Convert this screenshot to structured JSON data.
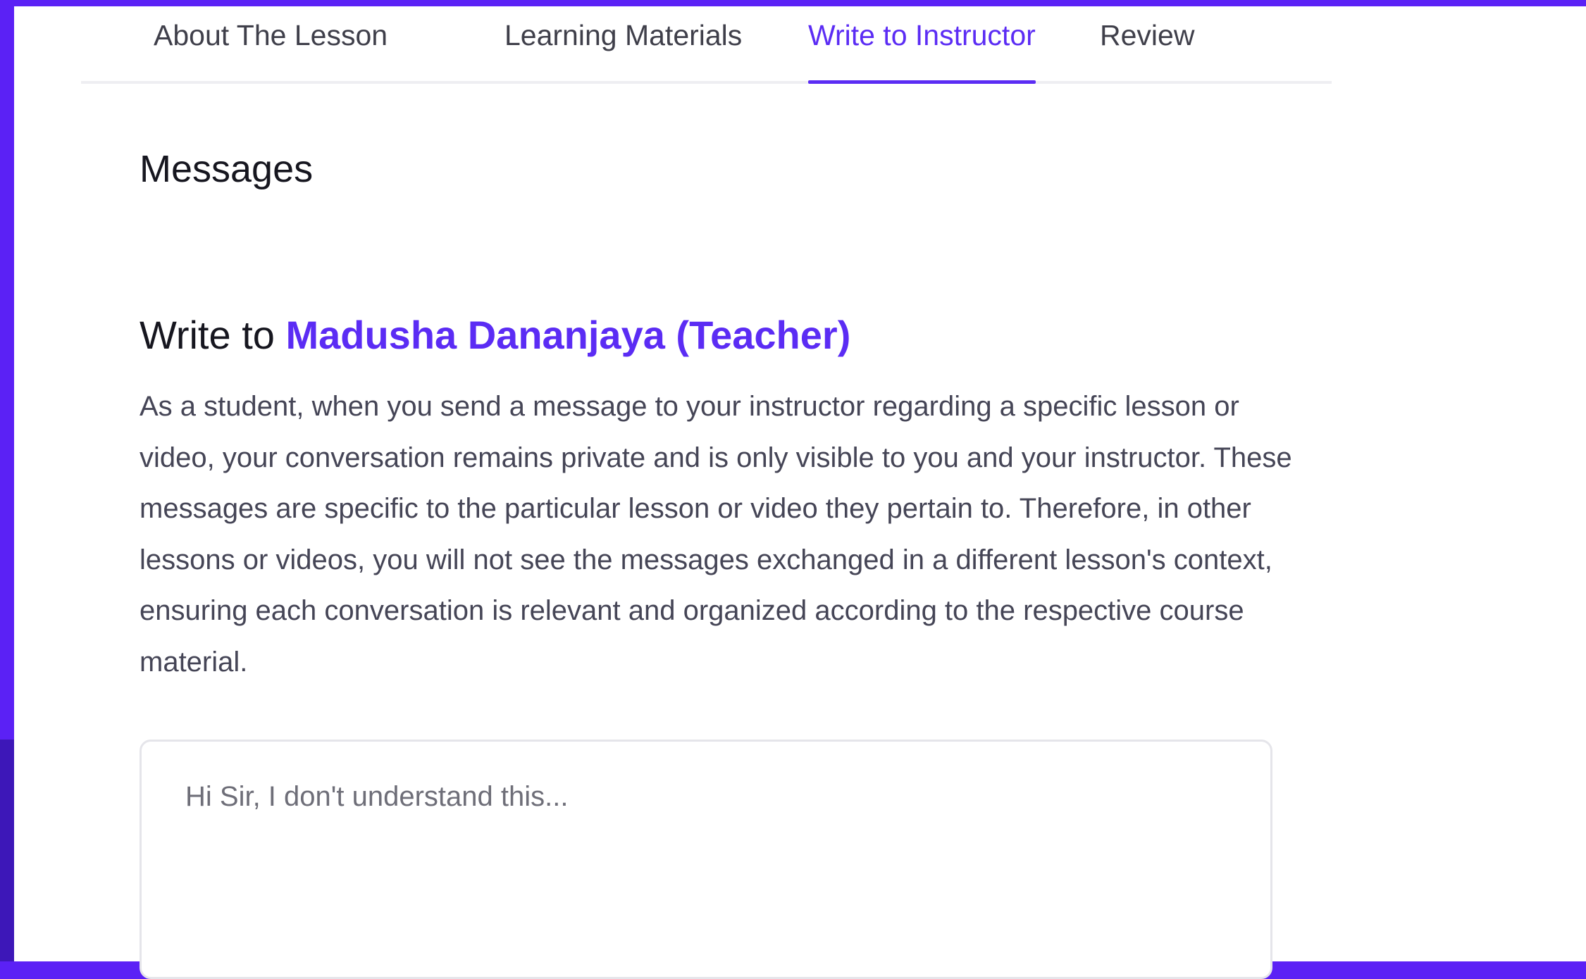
{
  "tabs": [
    {
      "label": "About The Lesson",
      "active": false
    },
    {
      "label": "Learning Materials",
      "active": false
    },
    {
      "label": "Write to Instructor",
      "active": true
    },
    {
      "label": "Review",
      "active": false
    }
  ],
  "messages": {
    "title": "Messages"
  },
  "write": {
    "prefix": "Write to ",
    "recipient": "Madusha Dananjaya (Teacher)",
    "description": "As a student, when you send a message to your instructor regarding a specific lesson or video, your conversation remains private and is only visible to you and your instructor. These messages are specific to the particular lesson or video they pertain to. Therefore, in other lessons or videos, you will not see the messages exchanged in a different lesson's context, ensuring each conversation is relevant and organized according to the respective course material.",
    "placeholder": "Hi Sir, I don't understand this..."
  },
  "colors": {
    "frame": "#5b21f5",
    "accent": "#5b2cf4"
  }
}
